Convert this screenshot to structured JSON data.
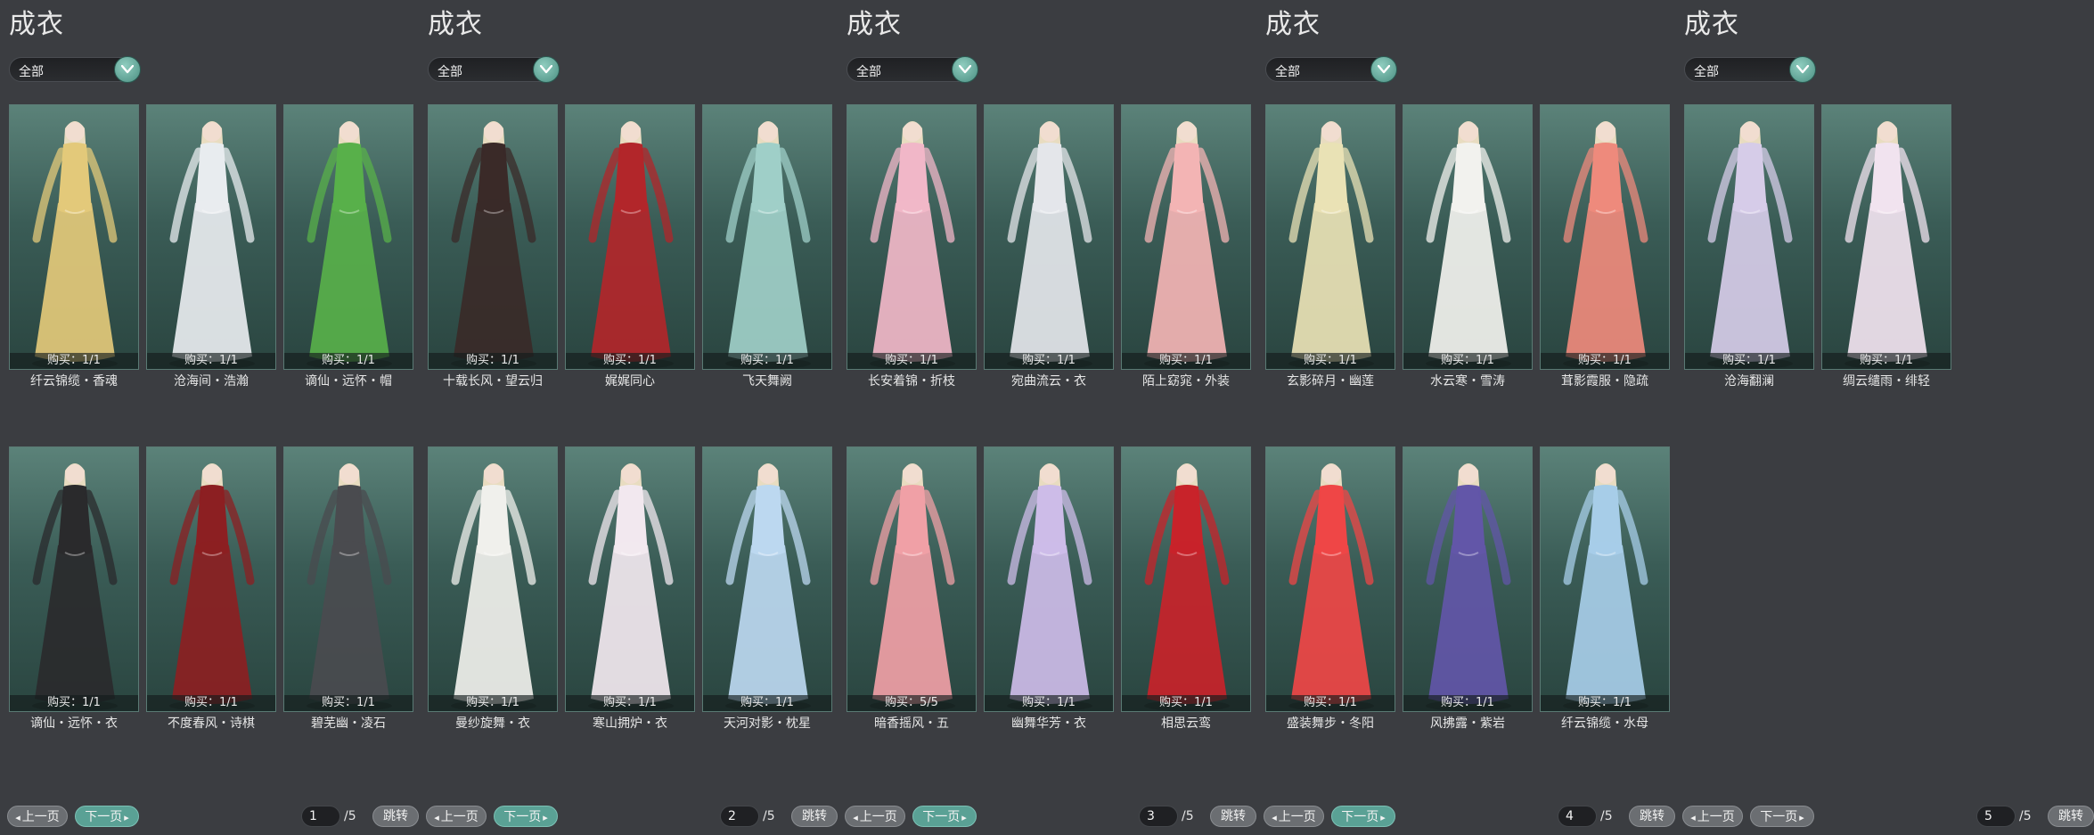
{
  "colors": {
    "background": "#3b3d41",
    "accent": "#5aa195",
    "card": "#3a5c56"
  },
  "panels": [
    {
      "title": "成衣",
      "filter": "全部",
      "items": [
        {
          "name": "纤云锦缆・香魂",
          "stock": "购买：1/1",
          "color": "#e3c97a"
        },
        {
          "name": "沧海间・浩瀚",
          "stock": "购买：1/1",
          "color": "#e8ecef"
        },
        {
          "name": "谪仙・远怀・帽",
          "stock": "购买：1/1",
          "color": "#58b04a"
        },
        {
          "name": "谪仙・远怀・衣",
          "stock": "购买：1/1",
          "color": "#2a2a2c"
        },
        {
          "name": "不度春风・诗棋",
          "stock": "购买：1/1",
          "color": "#8c1f22"
        },
        {
          "name": "碧芜幽・凌石",
          "stock": "购买：1/1",
          "color": "#4a4b4f"
        }
      ],
      "pager": {
        "prev": "上一页",
        "next": "下一页",
        "page": "1",
        "total": "/5",
        "jump": "跳转"
      }
    },
    {
      "title": "成衣",
      "filter": "全部",
      "items": [
        {
          "name": "十载长风・望云归",
          "stock": "购买：1/1",
          "color": "#3a2a28"
        },
        {
          "name": "娓娓同心",
          "stock": "购买：1/1",
          "color": "#b2262a"
        },
        {
          "name": "飞天舞阙",
          "stock": "购买：1/1",
          "color": "#9fcfc8"
        },
        {
          "name": "曼纱旋舞・衣",
          "stock": "购买：1/1",
          "color": "#f0f0ec"
        },
        {
          "name": "寒山拥炉・衣",
          "stock": "购买：1/1",
          "color": "#f2e8ef"
        },
        {
          "name": "天河对影・枕星",
          "stock": "购买：1/1",
          "color": "#bcd8f0"
        }
      ],
      "pager": {
        "prev": "上一页",
        "next": "下一页",
        "page": "2",
        "total": "/5",
        "jump": "跳转"
      }
    },
    {
      "title": "成衣",
      "filter": "全部",
      "items": [
        {
          "name": "长安着锦・折枝",
          "stock": "购买：1/1",
          "color": "#f1b7c8"
        },
        {
          "name": "宛曲流云・衣",
          "stock": "购买：1/1",
          "color": "#e4e6ea"
        },
        {
          "name": "陌上窈窕・外装",
          "stock": "购买：1/1",
          "color": "#f3b4b4"
        },
        {
          "name": "暗香摇风・五",
          "stock": "购买：5/5",
          "color": "#f0a0a6"
        },
        {
          "name": "幽舞华芳・衣",
          "stock": "购买：1/1",
          "color": "#cdbce8"
        },
        {
          "name": "相思云鸾",
          "stock": "购买：1/1",
          "color": "#c8232a"
        }
      ],
      "pager": {
        "prev": "上一页",
        "next": "下一页",
        "page": "3",
        "total": "/5",
        "jump": "跳转"
      }
    },
    {
      "title": "成衣",
      "filter": "全部",
      "items": [
        {
          "name": "玄影碎月・幽莲",
          "stock": "购买：1/1",
          "color": "#e9e2b5"
        },
        {
          "name": "水云寒・雪涛",
          "stock": "购买：1/1",
          "color": "#f2f2ee"
        },
        {
          "name": "茸影霞服・隐疏",
          "stock": "购买：1/1",
          "color": "#ee8a7c"
        },
        {
          "name": "盛装舞步・冬阳",
          "stock": "购买：1/1",
          "color": "#ef4646"
        },
        {
          "name": "风拂露・紫岩",
          "stock": "购买：1/1",
          "color": "#6256a8"
        },
        {
          "name": "纤云锦缆・水母",
          "stock": "购买：1/1",
          "color": "#a7cde8"
        }
      ],
      "pager": {
        "prev": "上一页",
        "next": "下一页",
        "page": "4",
        "total": "/5",
        "jump": "跳转"
      }
    },
    {
      "title": "成衣",
      "filter": "全部",
      "items": [
        {
          "name": "沧海翻澜",
          "stock": "购买：1/1",
          "color": "#d6cce8"
        },
        {
          "name": "绸云缱雨・绯轻",
          "stock": "购买：1/1",
          "color": "#f1e3ef"
        }
      ],
      "pager": {
        "prev": "上一页",
        "next": "下一页",
        "page": "5",
        "total": "/5",
        "jump": "跳转"
      }
    }
  ]
}
